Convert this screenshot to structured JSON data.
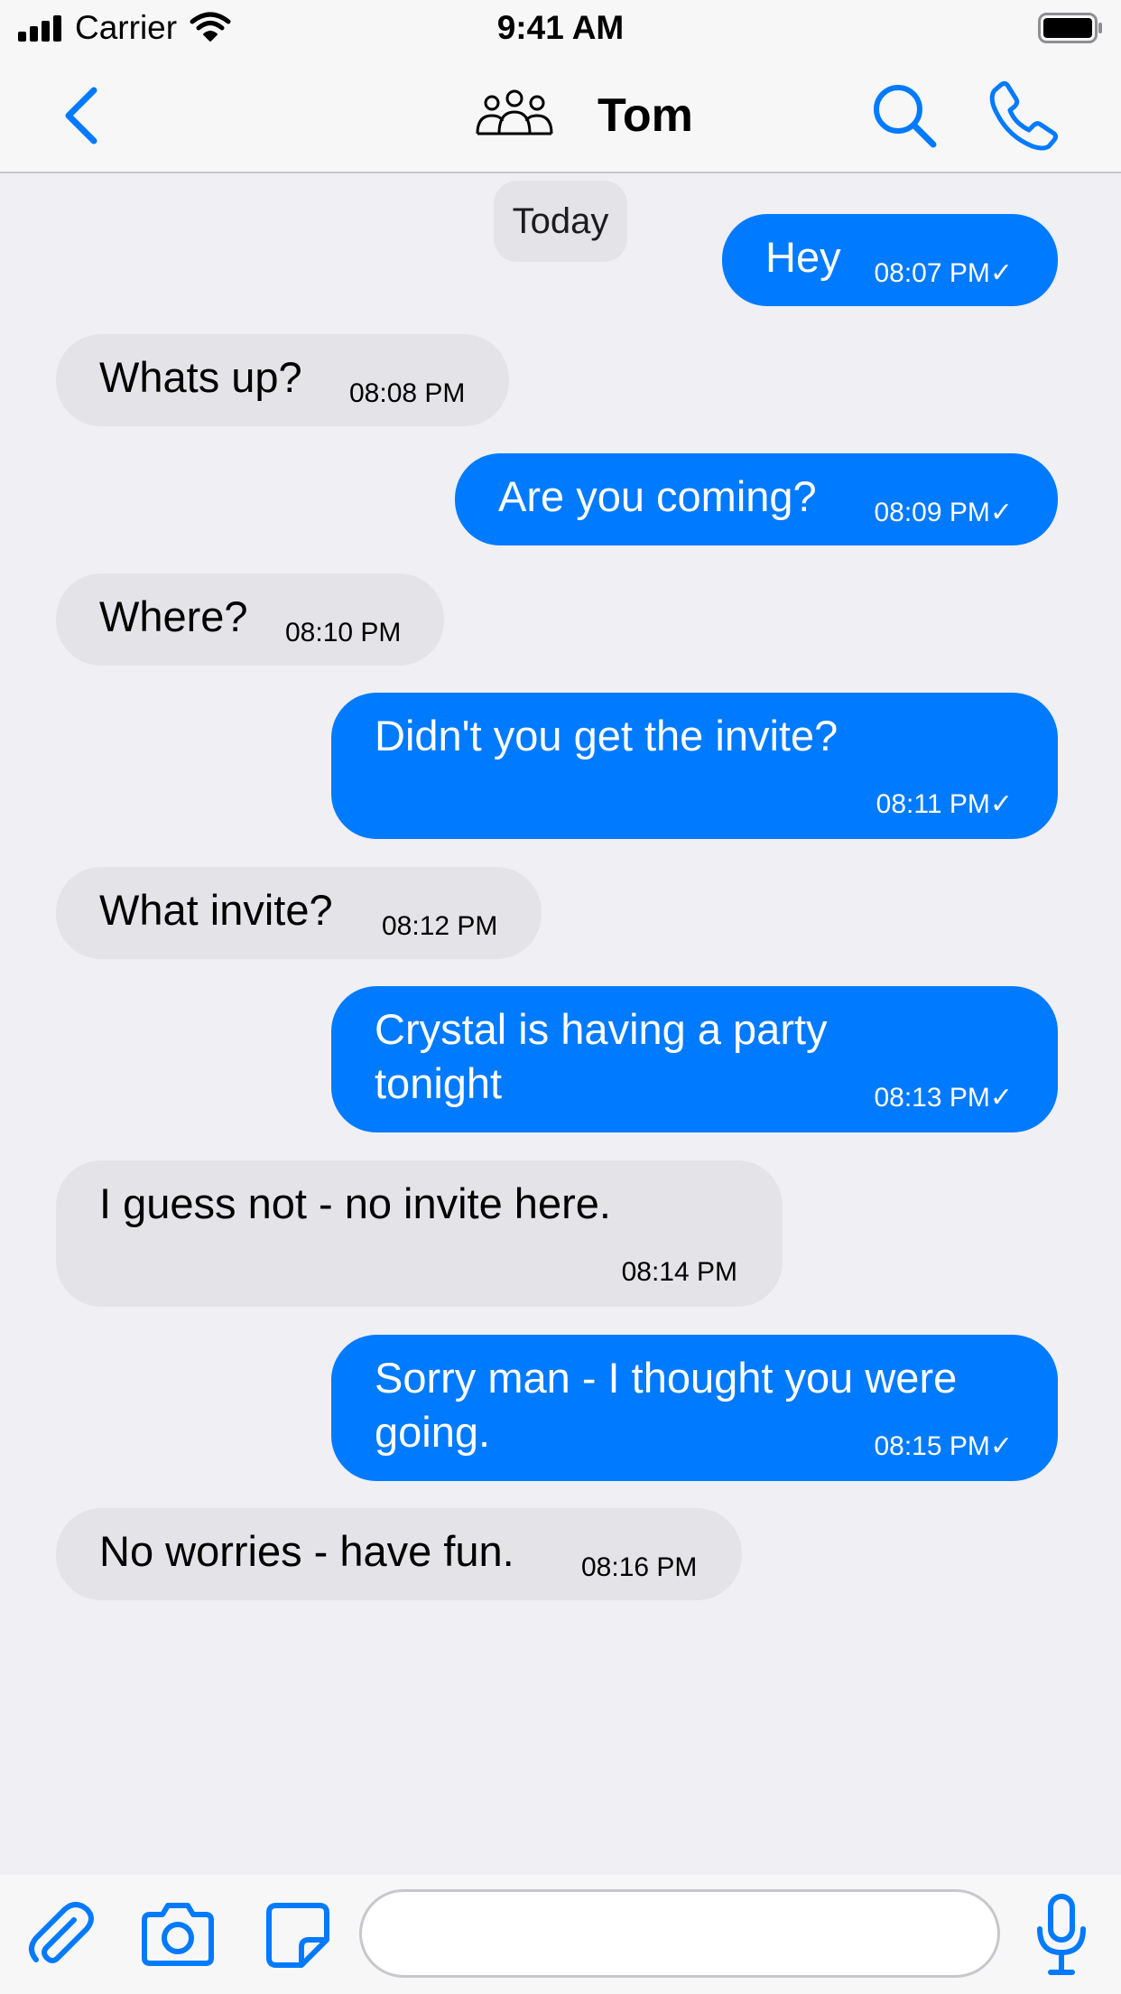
{
  "status_bar": {
    "carrier": "Carrier",
    "time": "9:41 AM"
  },
  "header": {
    "contact_name": "Tom",
    "icons": [
      "back-chevron-icon",
      "group-icon",
      "search-icon",
      "phone-icon"
    ]
  },
  "chat": {
    "date_divider": "Today",
    "messages": [
      {
        "direction": "outgoing",
        "text": "Hey",
        "time": "08:07 PM✓"
      },
      {
        "direction": "incoming",
        "text": "Whats up?",
        "time": "08:08 PM"
      },
      {
        "direction": "outgoing",
        "text": "Are you coming?",
        "time": "08:09 PM✓"
      },
      {
        "direction": "incoming",
        "text": "Where?",
        "time": "08:10 PM"
      },
      {
        "direction": "outgoing",
        "text": "Didn't you get the invite?",
        "time": "08:11 PM✓"
      },
      {
        "direction": "incoming",
        "text": "What invite?",
        "time": "08:12 PM"
      },
      {
        "direction": "outgoing",
        "text_lines": [
          "Crystal is having a party",
          "tonight"
        ],
        "time": "08:13 PM✓"
      },
      {
        "direction": "incoming",
        "text": "I guess not - no invite here.",
        "time": "08:14 PM"
      },
      {
        "direction": "outgoing",
        "text_lines": [
          "Sorry man - I thought you were",
          "going."
        ],
        "time": "08:15 PM✓"
      },
      {
        "direction": "incoming",
        "text": "No worries - have fun.",
        "time": "08:16 PM"
      }
    ]
  },
  "composer": {
    "input_value": "",
    "input_placeholder": "",
    "icons": [
      "paperclip-icon",
      "camera-icon",
      "sticker-icon",
      "microphone-icon"
    ]
  },
  "colors": {
    "accent": "#007aff",
    "outgoing_bubble": "#007aff",
    "incoming_bubble": "#e4e4e8",
    "background": "#efeff4"
  }
}
